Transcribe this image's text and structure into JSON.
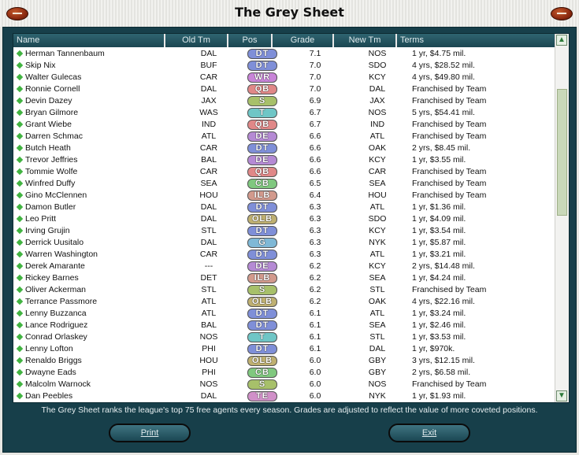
{
  "window": {
    "title": "The Grey Sheet"
  },
  "columns": {
    "name": "Name",
    "old_team": "Old Tm",
    "pos": "Pos",
    "grade": "Grade",
    "new_team": "New Tm",
    "terms": "Terms"
  },
  "position_colors": {
    "DT": "#7f8fd8",
    "WR": "#c884d8",
    "QB": "#e08888",
    "S": "#a7c06a",
    "T": "#6fc6c6",
    "DE": "#b58ad4",
    "CB": "#80c87f",
    "ILB": "#d29a8d",
    "OLB": "#bfb071",
    "G": "#7fb8d6",
    "TE": "#d090c8"
  },
  "players": [
    {
      "name": "Herman Tannenbaum",
      "old_team": "DAL",
      "pos": "DT",
      "grade": "7.1",
      "new_team": "NOS",
      "terms": "1 yr, $4.75 mil."
    },
    {
      "name": "Skip Nix",
      "old_team": "BUF",
      "pos": "DT",
      "grade": "7.0",
      "new_team": "SDO",
      "terms": "4 yrs, $28.52 mil."
    },
    {
      "name": "Walter Gulecas",
      "old_team": "CAR",
      "pos": "WR",
      "grade": "7.0",
      "new_team": "KCY",
      "terms": "4 yrs, $49.80 mil."
    },
    {
      "name": "Ronnie Cornell",
      "old_team": "DAL",
      "pos": "QB",
      "grade": "7.0",
      "new_team": "DAL",
      "terms": "Franchised by Team"
    },
    {
      "name": "Devin Dazey",
      "old_team": "JAX",
      "pos": "S",
      "grade": "6.9",
      "new_team": "JAX",
      "terms": "Franchised by Team"
    },
    {
      "name": "Bryan Gilmore",
      "old_team": "WAS",
      "pos": "T",
      "grade": "6.7",
      "new_team": "NOS",
      "terms": "5 yrs, $54.41 mil."
    },
    {
      "name": "Grant Wiebe",
      "old_team": "IND",
      "pos": "QB",
      "grade": "6.7",
      "new_team": "IND",
      "terms": "Franchised by Team"
    },
    {
      "name": "Darren Schmac",
      "old_team": "ATL",
      "pos": "DE",
      "grade": "6.6",
      "new_team": "ATL",
      "terms": "Franchised by Team"
    },
    {
      "name": "Butch Heath",
      "old_team": "CAR",
      "pos": "DT",
      "grade": "6.6",
      "new_team": "OAK",
      "terms": "2 yrs, $8.45 mil."
    },
    {
      "name": "Trevor Jeffries",
      "old_team": "BAL",
      "pos": "DE",
      "grade": "6.6",
      "new_team": "KCY",
      "terms": "1 yr, $3.55 mil."
    },
    {
      "name": "Tommie Wolfe",
      "old_team": "CAR",
      "pos": "QB",
      "grade": "6.6",
      "new_team": "CAR",
      "terms": "Franchised by Team"
    },
    {
      "name": "Winfred Duffy",
      "old_team": "SEA",
      "pos": "CB",
      "grade": "6.5",
      "new_team": "SEA",
      "terms": "Franchised by Team"
    },
    {
      "name": "Gino McClennen",
      "old_team": "HOU",
      "pos": "ILB",
      "grade": "6.4",
      "new_team": "HOU",
      "terms": "Franchised by Team"
    },
    {
      "name": "Damon Butler",
      "old_team": "DAL",
      "pos": "DT",
      "grade": "6.3",
      "new_team": "ATL",
      "terms": "1 yr, $1.36 mil."
    },
    {
      "name": "Leo Pritt",
      "old_team": "DAL",
      "pos": "OLB",
      "grade": "6.3",
      "new_team": "SDO",
      "terms": "1 yr, $4.09 mil."
    },
    {
      "name": "Irving Grujin",
      "old_team": "STL",
      "pos": "DT",
      "grade": "6.3",
      "new_team": "KCY",
      "terms": "1 yr, $3.54 mil."
    },
    {
      "name": "Derrick Uusitalo",
      "old_team": "DAL",
      "pos": "G",
      "grade": "6.3",
      "new_team": "NYK",
      "terms": "1 yr, $5.87 mil."
    },
    {
      "name": "Warren Washington",
      "old_team": "CAR",
      "pos": "DT",
      "grade": "6.3",
      "new_team": "ATL",
      "terms": "1 yr, $3.21 mil."
    },
    {
      "name": "Derek Amarante",
      "old_team": "---",
      "pos": "DE",
      "grade": "6.2",
      "new_team": "KCY",
      "terms": "2 yrs, $14.48 mil."
    },
    {
      "name": "Rickey Barnes",
      "old_team": "DET",
      "pos": "ILB",
      "grade": "6.2",
      "new_team": "SEA",
      "terms": "1 yr, $4.24 mil."
    },
    {
      "name": "Oliver Ackerman",
      "old_team": "STL",
      "pos": "S",
      "grade": "6.2",
      "new_team": "STL",
      "terms": "Franchised by Team"
    },
    {
      "name": "Terrance Passmore",
      "old_team": "ATL",
      "pos": "OLB",
      "grade": "6.2",
      "new_team": "OAK",
      "terms": "4 yrs, $22.16 mil."
    },
    {
      "name": "Lenny Buzzanca",
      "old_team": "ATL",
      "pos": "DT",
      "grade": "6.1",
      "new_team": "ATL",
      "terms": "1 yr, $3.24 mil."
    },
    {
      "name": "Lance Rodriguez",
      "old_team": "BAL",
      "pos": "DT",
      "grade": "6.1",
      "new_team": "SEA",
      "terms": "1 yr, $2.46 mil."
    },
    {
      "name": "Conrad Orlaskey",
      "old_team": "NOS",
      "pos": "T",
      "grade": "6.1",
      "new_team": "STL",
      "terms": "1 yr, $3.53 mil."
    },
    {
      "name": "Lenny Lofton",
      "old_team": "PHI",
      "pos": "DT",
      "grade": "6.1",
      "new_team": "DAL",
      "terms": "1 yr, $970k."
    },
    {
      "name": "Renaldo Briggs",
      "old_team": "HOU",
      "pos": "OLB",
      "grade": "6.0",
      "new_team": "GBY",
      "terms": "3 yrs, $12.15 mil."
    },
    {
      "name": "Dwayne Eads",
      "old_team": "PHI",
      "pos": "CB",
      "grade": "6.0",
      "new_team": "GBY",
      "terms": "2 yrs, $6.58 mil."
    },
    {
      "name": "Malcolm Warnock",
      "old_team": "NOS",
      "pos": "S",
      "grade": "6.0",
      "new_team": "NOS",
      "terms": "Franchised by Team"
    },
    {
      "name": "Dan Peebles",
      "old_team": "DAL",
      "pos": "TE",
      "grade": "6.0",
      "new_team": "NYK",
      "terms": "1 yr, $1.93 mil."
    }
  ],
  "footer_note": "The Grey Sheet ranks the league's top 75 free agents every season. Grades are adjusted to reflect the value of more coveted positions.",
  "buttons": {
    "print": "Print",
    "exit": "Exit"
  },
  "scrollbar": {
    "up_icon": "▲",
    "down_icon": "▼"
  }
}
